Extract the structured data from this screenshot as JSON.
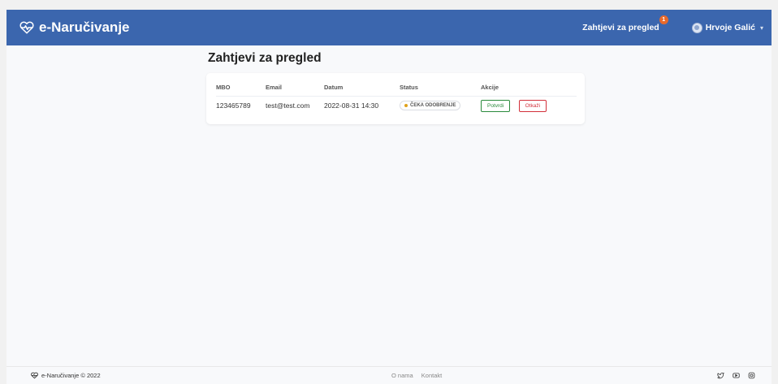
{
  "app": {
    "name": "e-Naručivanje",
    "brand_color": "#3b66ae"
  },
  "nav": {
    "requests_link": "Zahtjevi za pregled",
    "badge_count": "1",
    "user_name": "Hrvoje Galić"
  },
  "page": {
    "title": "Zahtjevi za pregled"
  },
  "table": {
    "headers": {
      "mbo": "MBO",
      "email": "Email",
      "datum": "Datum",
      "status": "Status",
      "akcije": "Akcije"
    },
    "rows": [
      {
        "mbo": "123465789",
        "email": "test@test.com",
        "datum": "2022-08-31 14:30",
        "status": "ČEKA ODOBRENJE",
        "confirm_label": "Potvrdi",
        "cancel_label": "Otkaži"
      }
    ]
  },
  "footer": {
    "copyright": "e-Naručivanje © 2022",
    "links": [
      "O nama",
      "Kontakt"
    ],
    "socials": [
      "twitter-icon",
      "youtube-icon",
      "instagram-icon"
    ]
  }
}
